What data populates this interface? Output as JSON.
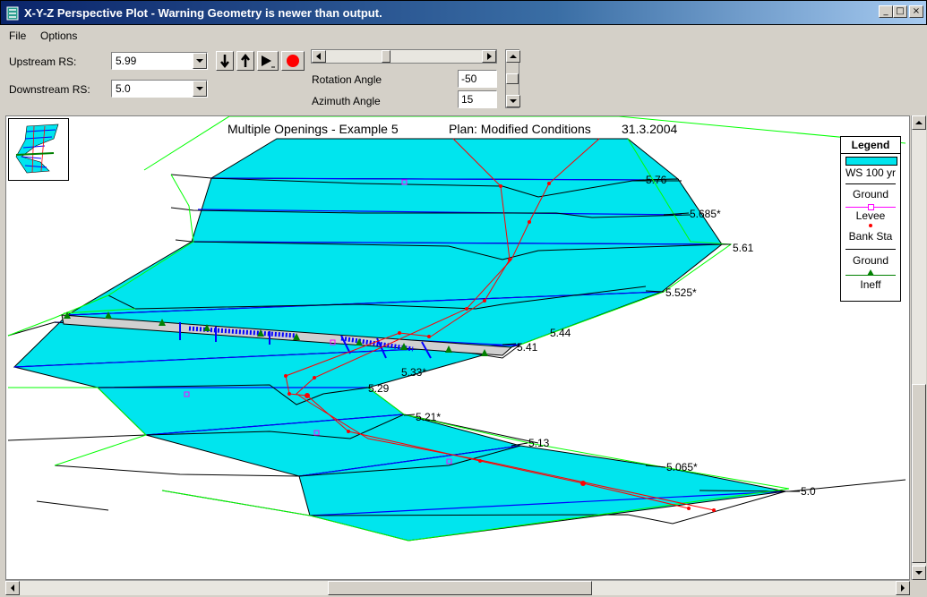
{
  "window": {
    "title": "X-Y-Z Perspective Plot - Warning Geometry is newer than output."
  },
  "menu": [
    "File",
    "Options"
  ],
  "controls": {
    "upstream_label": "Upstream RS:",
    "upstream_value": "5.99",
    "downstream_label": "Downstream RS:",
    "downstream_value": "5.0",
    "rotation_label": "Rotation Angle",
    "rotation_value": "-50",
    "azimuth_label": "Azimuth Angle",
    "azimuth_value": "15"
  },
  "plot": {
    "title_left": "Multiple Openings - Example 5",
    "title_plan": "Plan: Modified Conditions",
    "title_date": "31.3.2004",
    "river_stations": [
      "5.76",
      "5.685*",
      "5.61",
      "5.525*",
      "5.44",
      "5.41",
      "5.33*",
      "5.29",
      "5.21*",
      "5.13",
      "5.065*",
      "5.0"
    ]
  },
  "legend": {
    "title": "Legend",
    "items": [
      "WS 100 yr",
      "Ground",
      "Levee",
      "Bank Sta",
      "Ground",
      "Ineff"
    ]
  },
  "colors": {
    "water": "#00e5ee",
    "ws_line": "#0000ff",
    "ground": "#000000",
    "levee": "#ff00ff",
    "bank_sta": "#ff0000",
    "ineff": "#008000",
    "outline": "#00ff00",
    "titlebar": "#0a246a"
  }
}
